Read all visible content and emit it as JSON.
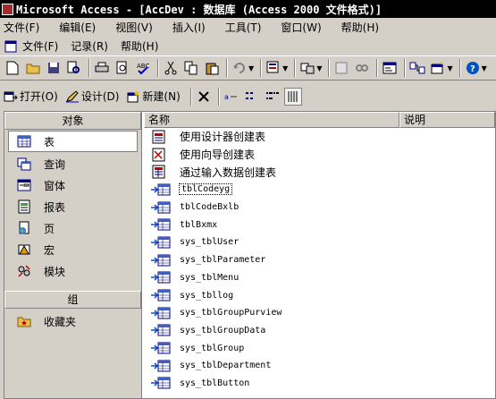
{
  "title": "Microsoft Access - [AccDev : 数据库 (Access 2000 文件格式)]",
  "menu_main": [
    "文件(F)",
    "编辑(E)",
    "视图(V)",
    "插入(I)",
    "工具(T)",
    "窗口(W)",
    "帮助(H)"
  ],
  "menu_doc": [
    "文件(F)",
    "记录(R)",
    "帮助(H)"
  ],
  "db_toolbar": {
    "open": "打开(O)",
    "design": "设计(D)",
    "new": "新建(N)"
  },
  "objects_header": "对象",
  "groups_header": "组",
  "object_types": [
    {
      "label": "表",
      "icon": "table-icon"
    },
    {
      "label": "查询",
      "icon": "query-icon"
    },
    {
      "label": "窗体",
      "icon": "form-icon"
    },
    {
      "label": "报表",
      "icon": "report-icon"
    },
    {
      "label": "页",
      "icon": "page-icon"
    },
    {
      "label": "宏",
      "icon": "macro-icon"
    },
    {
      "label": "模块",
      "icon": "module-icon"
    }
  ],
  "favorites": "收藏夹",
  "columns": {
    "name": "名称",
    "desc": "说明"
  },
  "shortcuts": [
    "使用设计器创建表",
    "使用向导创建表",
    "通过输入数据创建表"
  ],
  "tables": [
    "tblCodeyg",
    "tblCodeBxlb",
    "tblBxmx",
    "sys_tblUser",
    "sys_tblParameter",
    "sys_tblMenu",
    "sys_tbllog",
    "sys_tblGroupPurview",
    "sys_tblGroupData",
    "sys_tblGroup",
    "sys_tblDepartment",
    "sys_tblButton"
  ],
  "selected_table": "tblCodeyg"
}
